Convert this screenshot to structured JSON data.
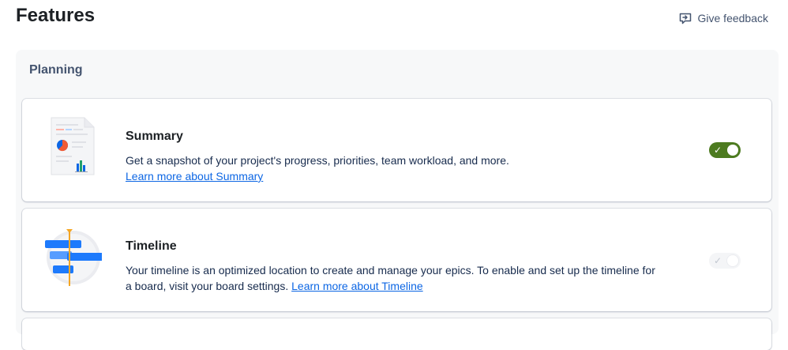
{
  "header": {
    "title": "Features",
    "feedback_label": "Give feedback",
    "feedback_icon": "feedback-icon"
  },
  "section": {
    "title": "Planning"
  },
  "features": [
    {
      "title": "Summary",
      "description": "Get a snapshot of your project's progress, priorities, team workload, and more.",
      "link": "Learn more about Summary",
      "enabled": true,
      "illustration": "summary-document-illustration"
    },
    {
      "title": "Timeline",
      "description": "Your timeline is an optimized location to create and manage your epics. To enable and set up the timeline for a board, visit your board settings.",
      "link": "Learn more about Timeline",
      "enabled": false,
      "illustration": "timeline-illustration"
    }
  ],
  "colors": {
    "toggle_on": "#4d7b20",
    "link": "#0c66e4",
    "section_bg": "#f7f8f9"
  }
}
